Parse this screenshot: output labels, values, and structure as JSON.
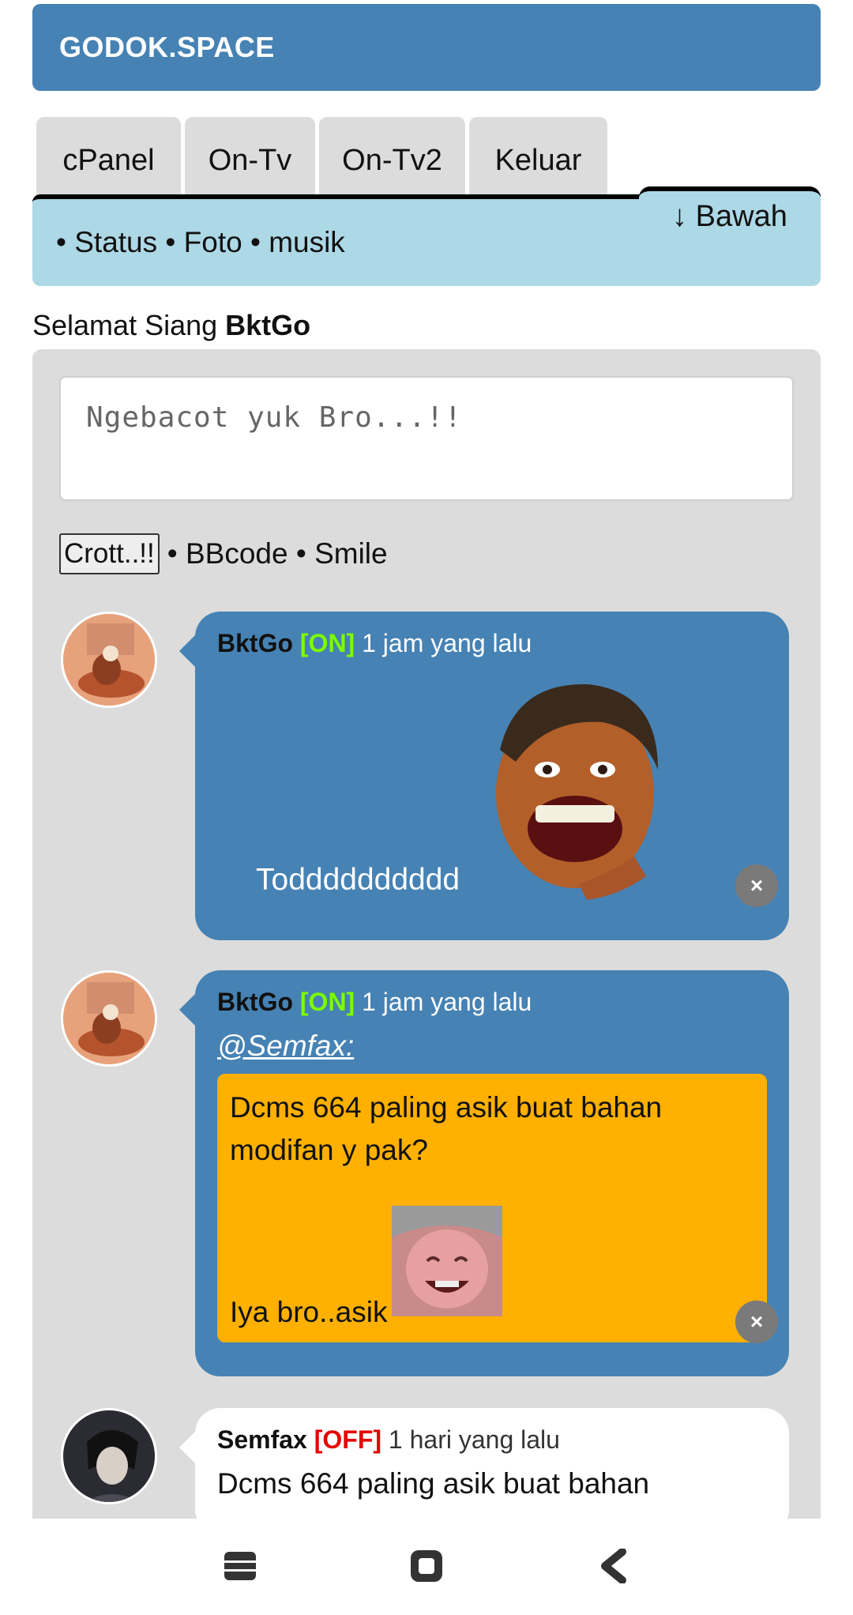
{
  "header": {
    "title": "GODOK.SPACE"
  },
  "tabs": [
    {
      "label": "cPanel"
    },
    {
      "label": "On-Tv"
    },
    {
      "label": "On-Tv2"
    },
    {
      "label": "Keluar"
    }
  ],
  "bawah_label": "↓ Bawah",
  "subnav": {
    "text": "• Status • Foto • musik"
  },
  "greeting": {
    "prefix": "Selamat Siang ",
    "user": "BktGo"
  },
  "composer": {
    "placeholder": "Ngebacot yuk Bro...!!",
    "submit_label": "Crott..!!",
    "links_text": " • BBcode • Smile"
  },
  "posts": [
    {
      "user": "BktGo",
      "status": "[ON]",
      "time": "1 jam yang lalu",
      "message": "Todddddddddd",
      "has_sticker": true,
      "close": "×"
    },
    {
      "user": "BktGo",
      "status": "[ON]",
      "time": "1 jam yang lalu",
      "mention": "@Semfax:",
      "quote": "Dcms 664 paling asik buat bahan modifan y pak?",
      "reply": "Iya bro..asik",
      "close": "×"
    },
    {
      "user": "Semfax",
      "status": "[OFF]",
      "time": "1 hari yang lalu",
      "message": "Dcms 664 paling asik buat bahan"
    }
  ],
  "colors": {
    "accent": "#4682b4",
    "subnav": "#add8e6",
    "panel": "#dcdcdc",
    "quote": "#ffb000",
    "online": "#7cfc00",
    "offline": "#e60000"
  }
}
